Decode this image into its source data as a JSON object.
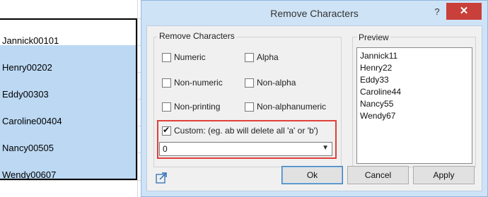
{
  "sheet": {
    "cells": [
      "Jannick00101",
      "Henry00202",
      "Eddy00303",
      "Caroline00404",
      "Nancy00505",
      "Wendy00607"
    ]
  },
  "dialog": {
    "title": "Remove Characters",
    "help_label": "?",
    "close_label": "✕",
    "group_label": "Remove Characters",
    "options": {
      "numeric": "Numeric",
      "alpha": "Alpha",
      "non_numeric": "Non-numeric",
      "non_alpha": "Non-alpha",
      "non_printing": "Non-printing",
      "non_alphanumeric": "Non-alphanumeric",
      "custom": "Custom: (eg. ab will delete all 'a' or 'b')"
    },
    "custom_checked": true,
    "custom_value": "0",
    "preview_label": "Preview",
    "preview_items": [
      "Jannick11",
      "Henry22",
      "Eddy33",
      "Caroline44",
      "Nancy55",
      "Wendy67"
    ],
    "buttons": {
      "ok": "Ok",
      "cancel": "Cancel",
      "apply": "Apply"
    }
  },
  "colors": {
    "dialog_frame": "#cfe3f6",
    "close_button": "#c9403a",
    "highlight_border": "#e0403a",
    "selection_fill": "#bcd8f3"
  }
}
